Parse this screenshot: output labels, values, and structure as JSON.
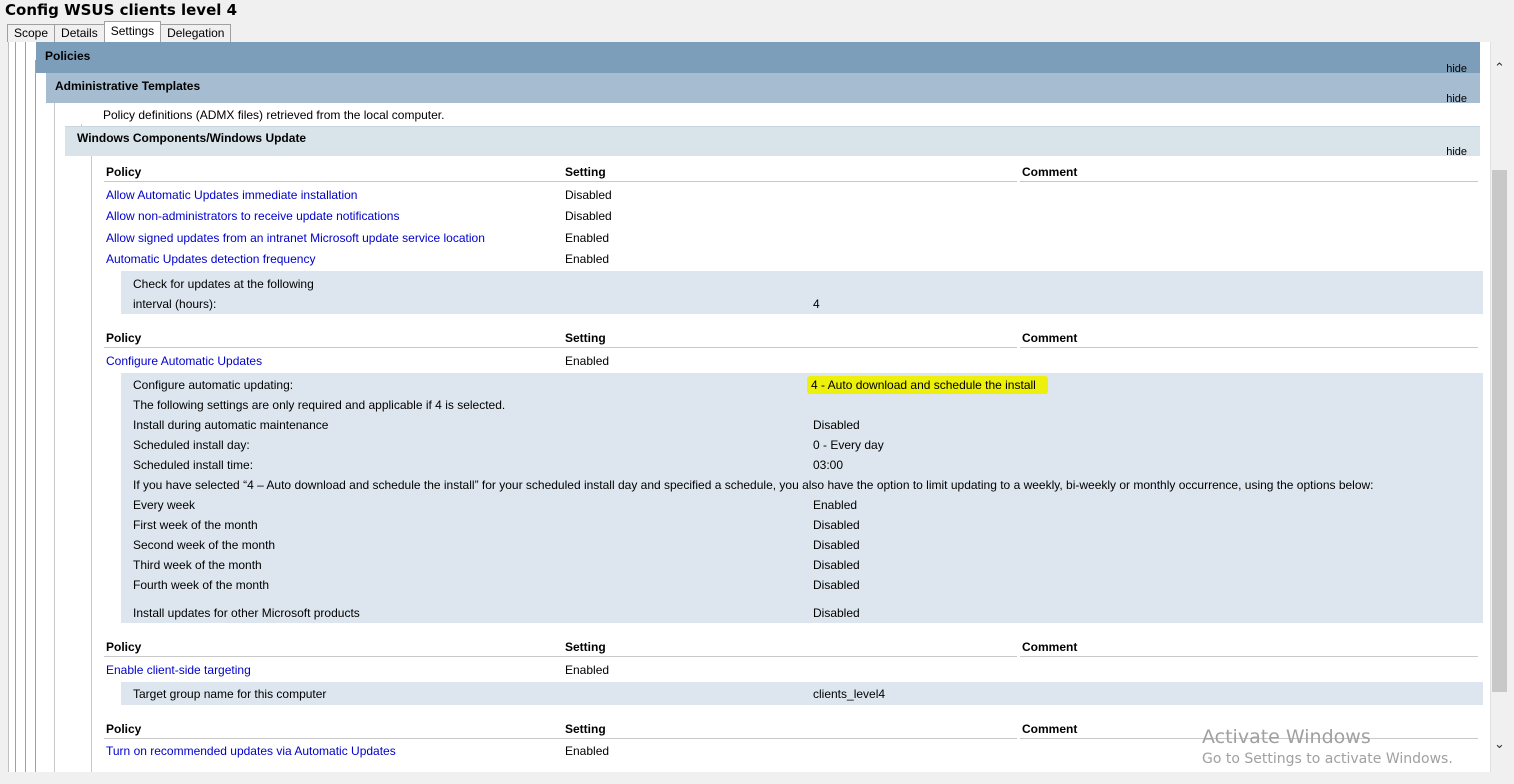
{
  "window": {
    "title": "Config WSUS clients level 4"
  },
  "tabs": [
    "Scope",
    "Details",
    "Settings",
    "Delegation"
  ],
  "sections": {
    "policies": {
      "label": "Policies",
      "hide": "hide"
    },
    "admin_templates": {
      "label": "Administrative Templates",
      "hide": "hide",
      "note": "Policy definitions (ADMX files) retrieved from the local computer."
    },
    "windows_update": {
      "label": "Windows Components/Windows Update",
      "hide": "hide"
    }
  },
  "headers": {
    "policy": "Policy",
    "setting": "Setting",
    "comment": "Comment"
  },
  "group1": {
    "rows": [
      {
        "policy": "Allow Automatic Updates immediate installation",
        "setting": "Disabled"
      },
      {
        "policy": "Allow non-administrators to receive update notifications",
        "setting": "Disabled"
      },
      {
        "policy": "Allow signed updates from an intranet Microsoft update service location",
        "setting": "Enabled"
      },
      {
        "policy": "Automatic Updates detection frequency",
        "setting": "Enabled"
      }
    ],
    "detail": {
      "label_line1": "Check for updates at the following",
      "label_line2": "interval (hours):",
      "value": "4"
    }
  },
  "group2": {
    "policy": "Configure Automatic Updates",
    "setting": "Enabled",
    "details": [
      {
        "label": "Configure automatic updating:",
        "value": "4 - Auto download and schedule the install"
      },
      {
        "label": "The following settings are only required and applicable if 4 is selected.",
        "value": ""
      },
      {
        "label": "Install during automatic maintenance",
        "value": "Disabled"
      },
      {
        "label": "Scheduled install day:",
        "value": "0 - Every day"
      },
      {
        "label": "Scheduled install time:",
        "value": "03:00"
      },
      {
        "label": "If you have selected “4 – Auto download and schedule the install” for your scheduled install day and specified a schedule, you also have the option to limit updating to a weekly, bi-weekly or monthly occurrence, using the options below:",
        "value": ""
      },
      {
        "label": "Every week",
        "value": "Enabled"
      },
      {
        "label": "First week of the month",
        "value": "Disabled"
      },
      {
        "label": "Second week of the month",
        "value": "Disabled"
      },
      {
        "label": "Third week of the month",
        "value": "Disabled"
      },
      {
        "label": "Fourth week of the month",
        "value": "Disabled"
      },
      {
        "label": "Install updates for other Microsoft products",
        "value": "Disabled"
      }
    ]
  },
  "group3": {
    "policy": "Enable client-side targeting",
    "setting": "Enabled",
    "detail": {
      "label": "Target group name for this computer",
      "value": "clients_level4"
    }
  },
  "group4": {
    "policy": "Turn on recommended updates via Automatic Updates",
    "setting": "Enabled"
  },
  "watermark": {
    "line1": "Activate Windows",
    "line2": "Go to Settings to activate Windows."
  },
  "colors": {
    "band_dark": "#7d9eba",
    "band_mid": "#a6bdd1",
    "band_light": "#d9e3ea",
    "detail_bg": "#dde6ee",
    "highlight": "#ecf00b",
    "link": "#0000cc"
  },
  "icons": {
    "scroll_up": "⌃",
    "scroll_down": "⌄"
  }
}
